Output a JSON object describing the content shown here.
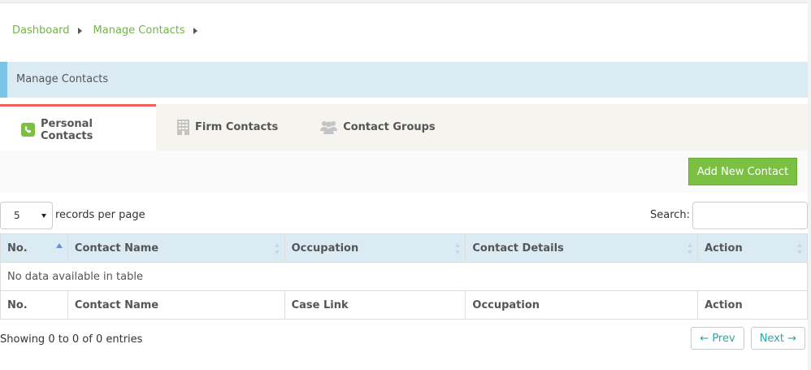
{
  "breadcrumb": {
    "items": [
      "Dashboard",
      "Manage Contacts"
    ]
  },
  "panel": {
    "title": "Manage Contacts"
  },
  "tabs": [
    {
      "label": "Personal Contacts",
      "icon": "phone-icon",
      "active": true
    },
    {
      "label": "Firm Contacts",
      "icon": "building-icon",
      "active": false
    },
    {
      "label": "Contact Groups",
      "icon": "users-icon",
      "active": false
    }
  ],
  "toolbar": {
    "add_label": "Add New Contact"
  },
  "length_menu": {
    "value": "5",
    "label": "records per page"
  },
  "search": {
    "label": "Search:",
    "value": ""
  },
  "table": {
    "headers": [
      "No.",
      "Contact Name",
      "Occupation",
      "Contact Details",
      "Action"
    ],
    "empty_text": "No data available in table",
    "footers": [
      "No.",
      "Contact Name",
      "Case Link",
      "Occupation",
      "Action"
    ]
  },
  "info": "Showing 0 to 0 of 0 entries",
  "pager": {
    "prev": "← Prev",
    "next": "Next →"
  },
  "colors": {
    "accent_green": "#7bc043",
    "link_green": "#72b34a",
    "header_blue": "#dbebf4",
    "tab_active": "#f1605a"
  }
}
